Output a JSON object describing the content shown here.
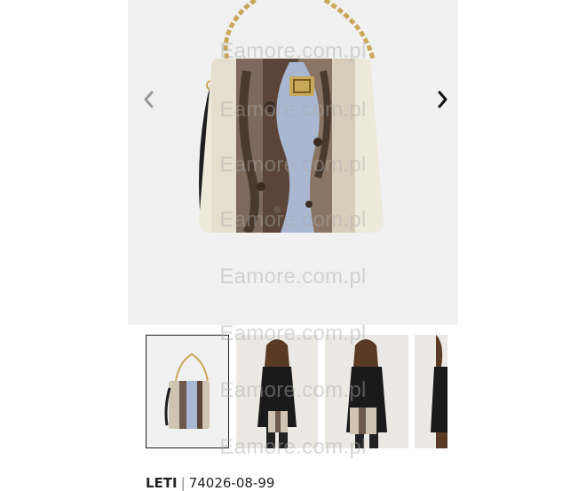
{
  "gallery": {
    "prev_icon": "chevron-left-icon",
    "next_icon": "chevron-right-icon",
    "thumbnails": [
      {
        "label": "bag-front",
        "selected": true
      },
      {
        "label": "model-1",
        "selected": false
      },
      {
        "label": "model-2",
        "selected": false
      },
      {
        "label": "model-3",
        "selected": false
      }
    ],
    "colors": {
      "background": "#f1f1f1",
      "arrow": "#222222"
    }
  },
  "watermark": {
    "text": "Eamore.com.pl"
  },
  "product": {
    "name": "LETI",
    "separator": "|",
    "code": "74026-08-99"
  }
}
